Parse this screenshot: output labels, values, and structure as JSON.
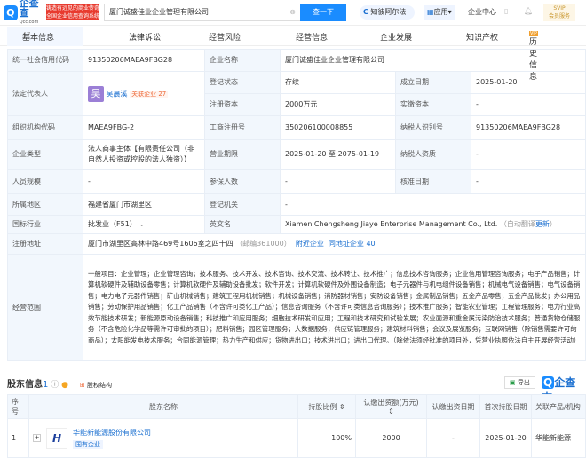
{
  "header": {
    "logo_text": "企查查",
    "logo_sub": "Qcc.com",
    "slogan": "铸造有远见的商业传奇 全国企业信用查询系统",
    "search_value": "厦门诚盛佳业企业管理有限公司",
    "search_button": "查一下",
    "alpha": "知彼阿尔法",
    "apps": "应用",
    "center": "企业中心",
    "svip": "SVIP",
    "svip_sub": "会员服务"
  },
  "tabs": [
    {
      "label": "基本信息",
      "count": "47"
    },
    {
      "label": "法律诉讼"
    },
    {
      "label": "经营风险"
    },
    {
      "label": "经营信息"
    },
    {
      "label": "企业发展"
    },
    {
      "label": "知识产权"
    },
    {
      "label": "历史信息",
      "badge": "VIP"
    }
  ],
  "info": {
    "credit_code_l": "统一社会信用代码",
    "credit_code": "91350206MAEA9FBG28",
    "name_l": "企业名称",
    "name": "厦门诚盛佳业企业管理有限公司",
    "legal_l": "法定代表人",
    "legal_avatar": "吴",
    "legal": "吴晨溪",
    "legal_rel": "关联企业 27",
    "status_l": "登记状态",
    "status": "存续",
    "est_l": "成立日期",
    "est": "2025-01-20",
    "capital_l": "注册资本",
    "capital": "2000万元",
    "paid_l": "实缴资本",
    "paid": "-",
    "org_l": "组织机构代码",
    "org": "MAEA9FBG-2",
    "reg_l": "工商注册号",
    "reg": "350206100008855",
    "tax_l": "纳税人识别号",
    "tax": "91350206MAEA9FBG28",
    "type_l": "企业类型",
    "type": "法人商事主体【有限责任公司（非自然人投资或控股的法人独资）】",
    "term_l": "营业期限",
    "term": "2025-01-20 至 2075-01-19",
    "taxq_l": "纳税人资质",
    "taxq": "-",
    "staff_l": "人员规模",
    "staff": "-",
    "insured_l": "参保人数",
    "insured": "-",
    "approve_l": "核准日期",
    "approve": "-",
    "region_l": "所属地区",
    "region": "福建省厦门市湖里区",
    "authority_l": "登记机关",
    "authority": "-",
    "industry_l": "国标行业",
    "industry": "批发业（F51）",
    "en_l": "英文名",
    "en": "Xiamen Chengsheng Jiaye Enterprise Management Co., Ltd.",
    "en_note": "（自动翻译",
    "en_update": "更新",
    "addr_l": "注册地址",
    "addr": "厦门市湖里区高林中路469号1606室之四十四",
    "zip": "（邮编361000）",
    "nearby": "附近企业",
    "same_addr": "同地址企业 40",
    "scope_l": "经营范围",
    "scope": "一般项目：企业管理；企业管理咨询；技术服务、技术开发、技术咨询、技术交流、技术转让、技术推广；信息技术咨询服务；企业信用管理咨询服务；电子产品销售；计算机软硬件及辅助设备零售；计算机软硬件及辅助设备批发；软件开发；计算机软硬件及外围设备制造；电子元器件与机电组件设备销售；机械电气设备销售；电气设备销售；电力电子元器件销售；矿山机械销售；建筑工程用机械销售；机械设备销售；消防器材销售；安防设备销售；金属制品销售；五金产品零售；五金产品批发；办公用品销售；劳动保护用品销售；化工产品销售（不含许可类化工产品）；信息咨询服务（不含许可类信息咨询服务）；技术推广服务；智能农业管理；工程管理服务；电力行业高效节能技术研发；新能源原动设备销售；科技推广和应用服务；细胞技术研发和应用；工程和技术研究和试验发展；农业面源和重金属污染防治技术服务；普通货物仓储服务（不含危险化学品等需许可审批的项目）；肥料销售；园区管理服务；大数据服务；供应链管理服务；建筑材料销售；会议及展览服务；互联网销售（除销售需要许可的商品）；太阳能发电技术服务；合同能源管理；热力生产和供应；货物进出口；技术进出口；进出口代理。（除依法须经批准的项目外，凭营业执照依法自主开展经营活动）"
  },
  "shareholders": {
    "title": "股东信息",
    "count": "1",
    "equity": "股权结构",
    "export": "导出",
    "brand": "企查查",
    "columns": [
      "序号",
      "股东名称",
      "持股比例",
      "认缴出资额(万元)",
      "认缴出资日期",
      "首次持股日期",
      "关联产品/机构"
    ],
    "rows": [
      {
        "no": "1",
        "name": "华能新能源股份有限公司",
        "tag": "国有企业",
        "ratio": "100%",
        "amount": "2000",
        "date": "-",
        "first": "2025-01-20",
        "product": "华能新能源"
      }
    ]
  }
}
